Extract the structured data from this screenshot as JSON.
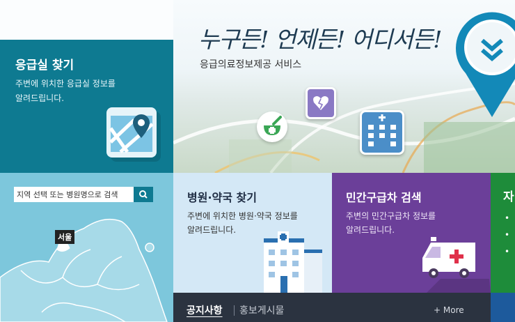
{
  "hero": {
    "slogan": "누구든! 언제든! 어디서든!",
    "subtitle": "응급의료정보제공 서비스"
  },
  "er_card": {
    "title": "응급실 찾기",
    "desc_line1": "주변에 위치한 응급실 정보를",
    "desc_line2": "알려드립니다."
  },
  "map_panel": {
    "search_placeholder": "지역 선택 또는 병원명으로 검색",
    "region_label": "서울"
  },
  "hospital_card": {
    "title": "병원·약국 찾기",
    "desc_line1": "주변에 위치한 병원·약국 정보를",
    "desc_line2": "알려드립니다."
  },
  "ambulance_card": {
    "title": "민간구급차 검색",
    "desc_line1": "주변의 민간구급차 정보를",
    "desc_line2": "알려드립니다."
  },
  "green_card": {
    "title": "자"
  },
  "notice": {
    "tab_notice": "공지사항",
    "tab_promo": "홍보게시물",
    "more": "+ More"
  },
  "colors": {
    "er_teal": "#0e7a91",
    "hospital_blue": "#d4e8f6",
    "ambulance_purple": "#6b3f99",
    "green": "#1e8c3a",
    "notice_dark": "#2b3340",
    "pin_blue": "#1389b8"
  }
}
